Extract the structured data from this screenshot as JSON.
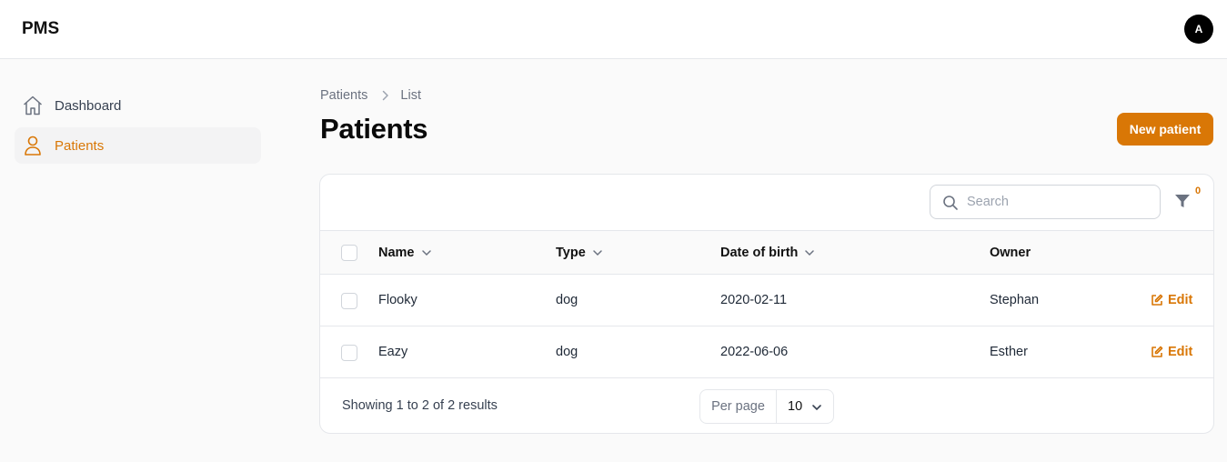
{
  "app": {
    "brand": "PMS",
    "avatar_initial": "A"
  },
  "sidebar": {
    "items": [
      {
        "label": "Dashboard",
        "icon": "home-icon",
        "active": false
      },
      {
        "label": "Patients",
        "icon": "user-icon",
        "active": true
      }
    ]
  },
  "breadcrumb": [
    "Patients",
    "List"
  ],
  "page": {
    "title": "Patients",
    "new_button": "New patient"
  },
  "toolbar": {
    "search_placeholder": "Search",
    "filter_count": "0"
  },
  "table": {
    "columns": [
      {
        "label": "Name",
        "sortable": true
      },
      {
        "label": "Type",
        "sortable": true
      },
      {
        "label": "Date of birth",
        "sortable": true
      },
      {
        "label": "Owner",
        "sortable": false
      }
    ],
    "rows": [
      {
        "name": "Flooky",
        "type": "dog",
        "dob": "2020-02-11",
        "owner": "Stephan",
        "action": "Edit"
      },
      {
        "name": "Eazy",
        "type": "dog",
        "dob": "2022-06-06",
        "owner": "Esther",
        "action": "Edit"
      }
    ]
  },
  "pagination": {
    "summary": "Showing 1 to 2 of 2 results",
    "per_page_label": "Per page",
    "per_page_value": "10"
  },
  "colors": {
    "accent": "#d97706",
    "border": "#e5e7eb",
    "text": "#111827"
  }
}
